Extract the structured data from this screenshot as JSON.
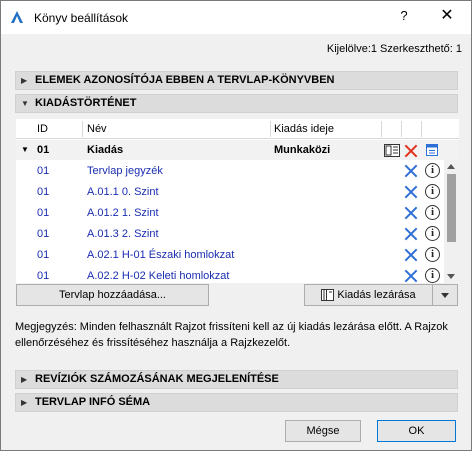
{
  "window": {
    "title": "Könyv beállítások",
    "help_label": "?",
    "close_label": "✕"
  },
  "selection_info": "Kijelölve:1 Szerkeszthető: 1",
  "sections": {
    "element_ids": "ELEMEK AZONOSÍTÓJA EBBEN A TERVLAP-KÖNYVBEN",
    "issue_history": "KIADÁSTÖRTÉNET",
    "revision_numbering": "REVÍZIÓK SZÁMOZÁSÁNAK MEGJELENÍTÉSE",
    "sheet_info": "TERVLAP INFÓ SÉMA"
  },
  "table": {
    "headers": {
      "id": "ID",
      "name": "Név",
      "issue_date": "Kiadás ideje"
    },
    "group": {
      "id": "01",
      "name": "Kiadás",
      "status": "Munkaközi"
    },
    "rows": [
      {
        "id": "01",
        "name": "Tervlap jegyzék"
      },
      {
        "id": "01",
        "name": "A.01.1 0. Szint"
      },
      {
        "id": "01",
        "name": "A.01.2 1. Szint"
      },
      {
        "id": "01",
        "name": "A.01.3 2. Szint"
      },
      {
        "id": "01",
        "name": "A.02.1 H-01 Északi homlokzat"
      },
      {
        "id": "01",
        "name": "A.02.2 H-02 Keleti homlokzat"
      }
    ]
  },
  "buttons": {
    "add_sheet": "Tervlap hozzáadása...",
    "close_issue": "Kiadás lezárása",
    "cancel": "Mégse",
    "ok": "OK"
  },
  "note": "Megjegyzés: Minden felhasznált Rajzot frissíteni kell az új kiadás lezárása előtt. A Rajzok ellenőrzéséhez és frissítéséhez használja a Rajzkezelőt.",
  "colors": {
    "link_blue": "#1a2db0",
    "delete_red": "#e0301e",
    "action_blue": "#2f6fd6"
  }
}
